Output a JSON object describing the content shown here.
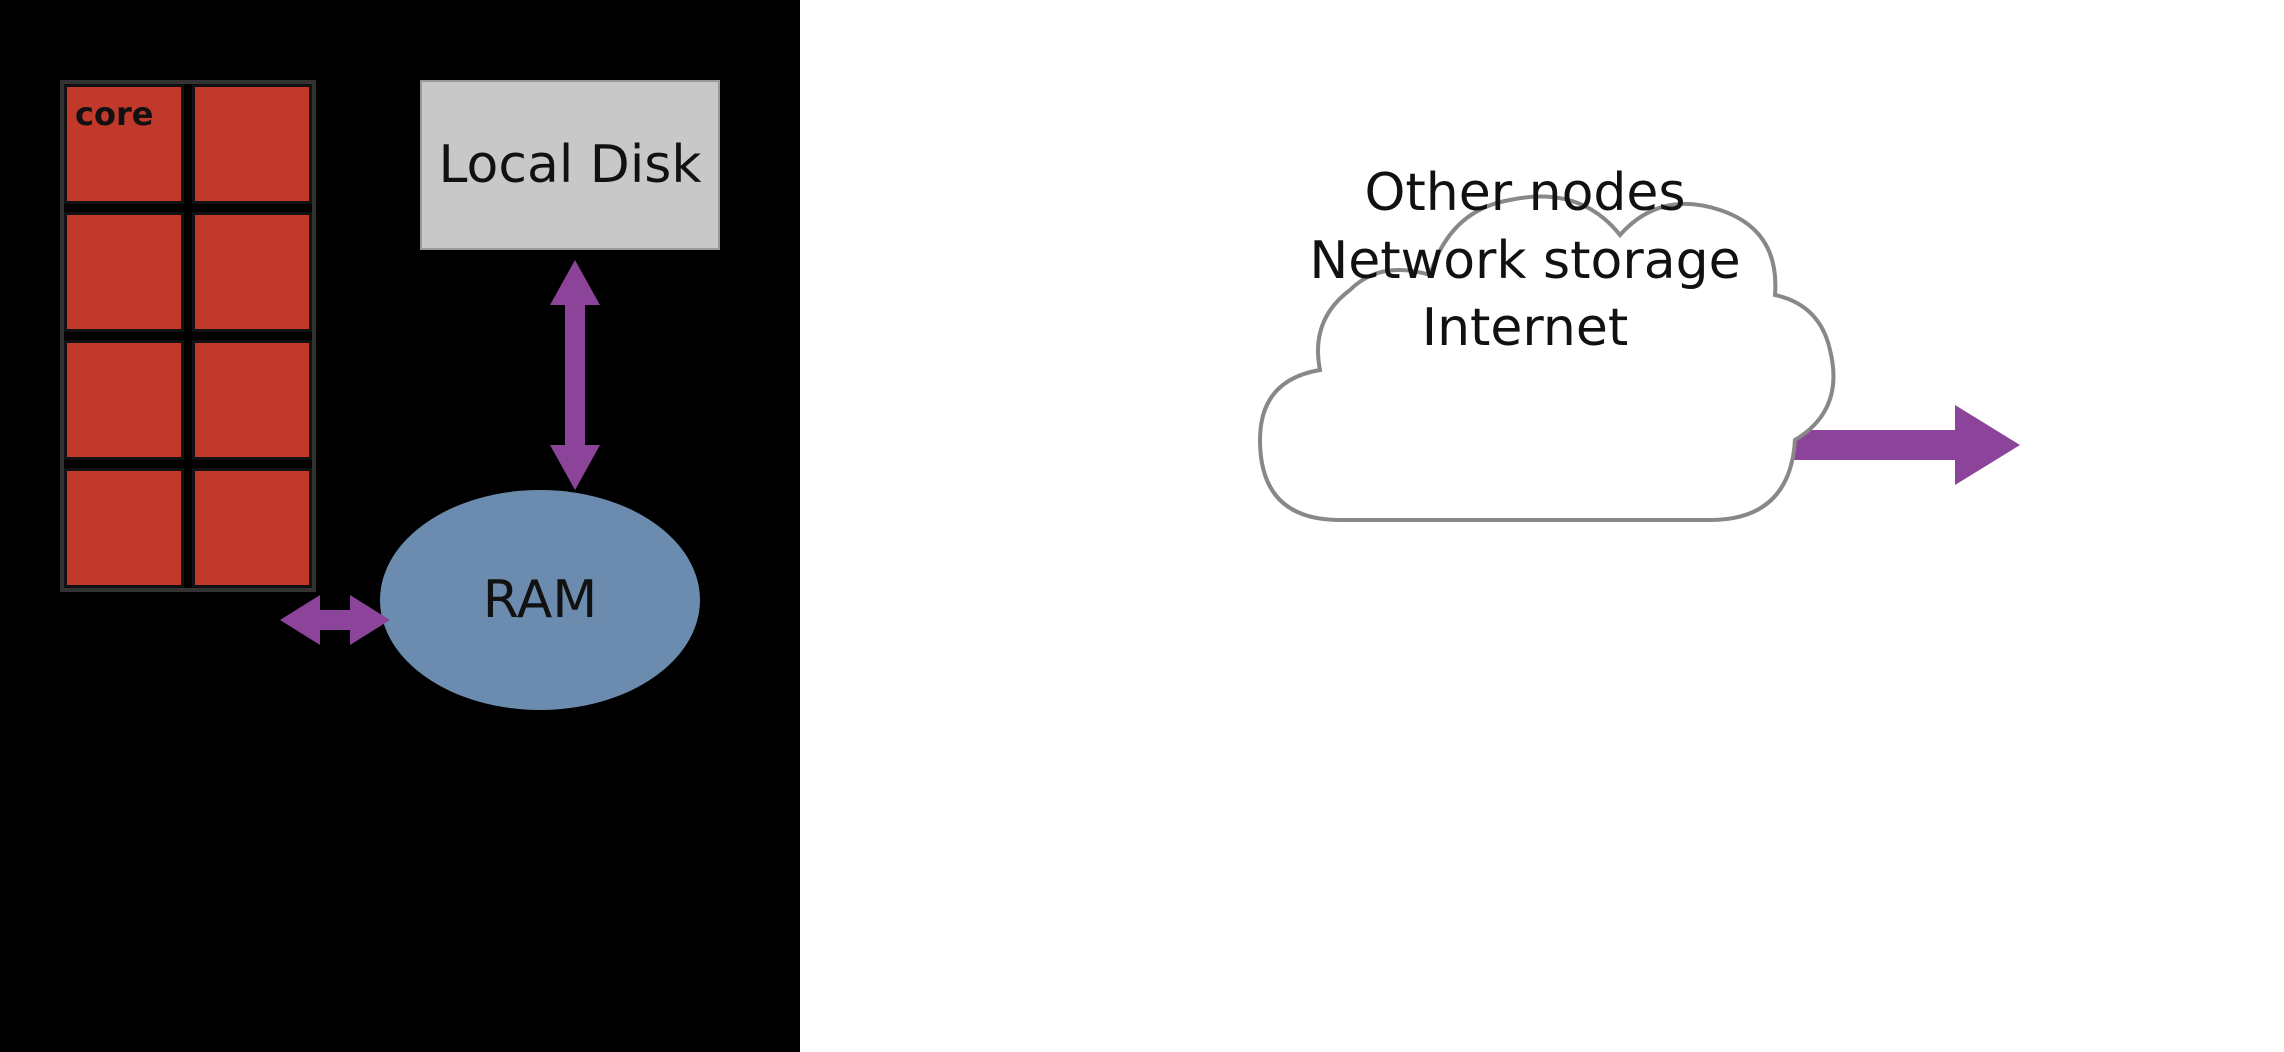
{
  "left_panel": {
    "background": "#000000"
  },
  "right_panel": {
    "background": "#ffffff"
  },
  "cpu": {
    "core_label": "core",
    "grid_rows": 4,
    "grid_cols": 2,
    "cell_color": "#c0392b"
  },
  "local_disk": {
    "label": "Local Disk",
    "background": "#c8c8c8"
  },
  "ram": {
    "label": "RAM",
    "background": "#6b8cae"
  },
  "cloud": {
    "lines": [
      "Other nodes",
      "Network storage",
      "Internet"
    ]
  },
  "arrows": {
    "color": "#8b449a",
    "vertical_label": "disk-ram-arrow",
    "horiz_cores_label": "cores-ram-arrow",
    "horiz_network_label": "ram-network-arrow"
  }
}
